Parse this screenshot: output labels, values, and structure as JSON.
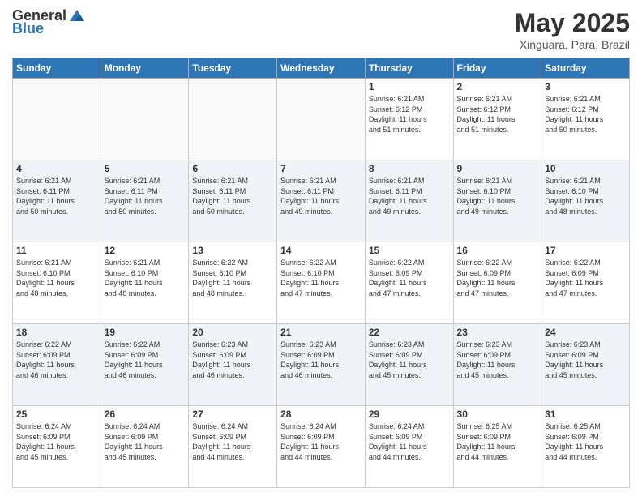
{
  "header": {
    "logo_general": "General",
    "logo_blue": "Blue",
    "month": "May 2025",
    "location": "Xinguara, Para, Brazil"
  },
  "weekdays": [
    "Sunday",
    "Monday",
    "Tuesday",
    "Wednesday",
    "Thursday",
    "Friday",
    "Saturday"
  ],
  "weeks": [
    [
      {
        "day": "",
        "info": ""
      },
      {
        "day": "",
        "info": ""
      },
      {
        "day": "",
        "info": ""
      },
      {
        "day": "",
        "info": ""
      },
      {
        "day": "1",
        "info": "Sunrise: 6:21 AM\nSunset: 6:12 PM\nDaylight: 11 hours\nand 51 minutes."
      },
      {
        "day": "2",
        "info": "Sunrise: 6:21 AM\nSunset: 6:12 PM\nDaylight: 11 hours\nand 51 minutes."
      },
      {
        "day": "3",
        "info": "Sunrise: 6:21 AM\nSunset: 6:12 PM\nDaylight: 11 hours\nand 50 minutes."
      }
    ],
    [
      {
        "day": "4",
        "info": "Sunrise: 6:21 AM\nSunset: 6:11 PM\nDaylight: 11 hours\nand 50 minutes."
      },
      {
        "day": "5",
        "info": "Sunrise: 6:21 AM\nSunset: 6:11 PM\nDaylight: 11 hours\nand 50 minutes."
      },
      {
        "day": "6",
        "info": "Sunrise: 6:21 AM\nSunset: 6:11 PM\nDaylight: 11 hours\nand 50 minutes."
      },
      {
        "day": "7",
        "info": "Sunrise: 6:21 AM\nSunset: 6:11 PM\nDaylight: 11 hours\nand 49 minutes."
      },
      {
        "day": "8",
        "info": "Sunrise: 6:21 AM\nSunset: 6:11 PM\nDaylight: 11 hours\nand 49 minutes."
      },
      {
        "day": "9",
        "info": "Sunrise: 6:21 AM\nSunset: 6:10 PM\nDaylight: 11 hours\nand 49 minutes."
      },
      {
        "day": "10",
        "info": "Sunrise: 6:21 AM\nSunset: 6:10 PM\nDaylight: 11 hours\nand 48 minutes."
      }
    ],
    [
      {
        "day": "11",
        "info": "Sunrise: 6:21 AM\nSunset: 6:10 PM\nDaylight: 11 hours\nand 48 minutes."
      },
      {
        "day": "12",
        "info": "Sunrise: 6:21 AM\nSunset: 6:10 PM\nDaylight: 11 hours\nand 48 minutes."
      },
      {
        "day": "13",
        "info": "Sunrise: 6:22 AM\nSunset: 6:10 PM\nDaylight: 11 hours\nand 48 minutes."
      },
      {
        "day": "14",
        "info": "Sunrise: 6:22 AM\nSunset: 6:10 PM\nDaylight: 11 hours\nand 47 minutes."
      },
      {
        "day": "15",
        "info": "Sunrise: 6:22 AM\nSunset: 6:09 PM\nDaylight: 11 hours\nand 47 minutes."
      },
      {
        "day": "16",
        "info": "Sunrise: 6:22 AM\nSunset: 6:09 PM\nDaylight: 11 hours\nand 47 minutes."
      },
      {
        "day": "17",
        "info": "Sunrise: 6:22 AM\nSunset: 6:09 PM\nDaylight: 11 hours\nand 47 minutes."
      }
    ],
    [
      {
        "day": "18",
        "info": "Sunrise: 6:22 AM\nSunset: 6:09 PM\nDaylight: 11 hours\nand 46 minutes."
      },
      {
        "day": "19",
        "info": "Sunrise: 6:22 AM\nSunset: 6:09 PM\nDaylight: 11 hours\nand 46 minutes."
      },
      {
        "day": "20",
        "info": "Sunrise: 6:23 AM\nSunset: 6:09 PM\nDaylight: 11 hours\nand 46 minutes."
      },
      {
        "day": "21",
        "info": "Sunrise: 6:23 AM\nSunset: 6:09 PM\nDaylight: 11 hours\nand 46 minutes."
      },
      {
        "day": "22",
        "info": "Sunrise: 6:23 AM\nSunset: 6:09 PM\nDaylight: 11 hours\nand 45 minutes."
      },
      {
        "day": "23",
        "info": "Sunrise: 6:23 AM\nSunset: 6:09 PM\nDaylight: 11 hours\nand 45 minutes."
      },
      {
        "day": "24",
        "info": "Sunrise: 6:23 AM\nSunset: 6:09 PM\nDaylight: 11 hours\nand 45 minutes."
      }
    ],
    [
      {
        "day": "25",
        "info": "Sunrise: 6:24 AM\nSunset: 6:09 PM\nDaylight: 11 hours\nand 45 minutes."
      },
      {
        "day": "26",
        "info": "Sunrise: 6:24 AM\nSunset: 6:09 PM\nDaylight: 11 hours\nand 45 minutes."
      },
      {
        "day": "27",
        "info": "Sunrise: 6:24 AM\nSunset: 6:09 PM\nDaylight: 11 hours\nand 44 minutes."
      },
      {
        "day": "28",
        "info": "Sunrise: 6:24 AM\nSunset: 6:09 PM\nDaylight: 11 hours\nand 44 minutes."
      },
      {
        "day": "29",
        "info": "Sunrise: 6:24 AM\nSunset: 6:09 PM\nDaylight: 11 hours\nand 44 minutes."
      },
      {
        "day": "30",
        "info": "Sunrise: 6:25 AM\nSunset: 6:09 PM\nDaylight: 11 hours\nand 44 minutes."
      },
      {
        "day": "31",
        "info": "Sunrise: 6:25 AM\nSunset: 6:09 PM\nDaylight: 11 hours\nand 44 minutes."
      }
    ]
  ]
}
